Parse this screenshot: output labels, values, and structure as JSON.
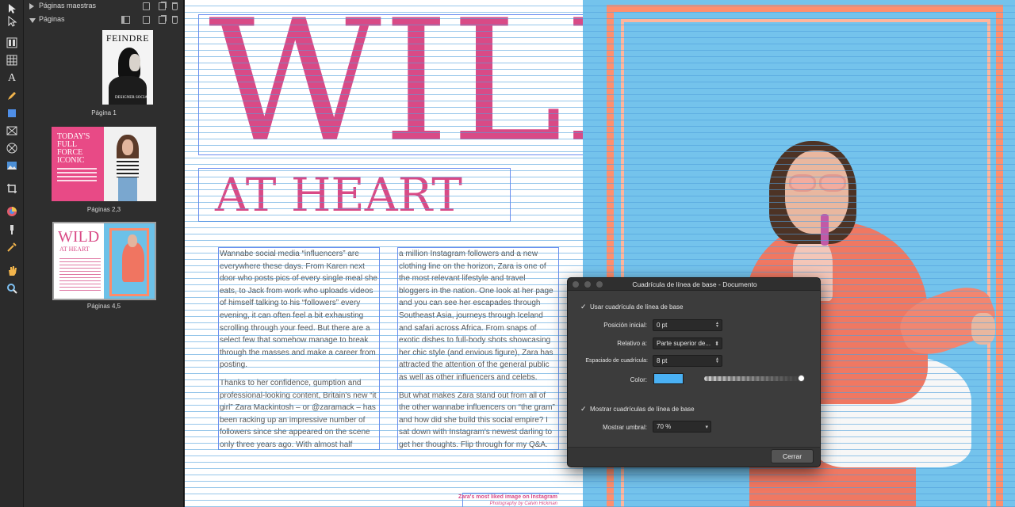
{
  "pages_panel": {
    "master_pages_label": "Páginas maestras",
    "pages_label": "Páginas",
    "thumbnails": [
      {
        "caption": "Página 1",
        "cover_title": "FEINDRE",
        "cover_footer": "DESIGNER SOCIAL"
      },
      {
        "caption": "Páginas 2,3",
        "cover_text": "TODAY'S FULL FORCE ICONIC"
      },
      {
        "caption": "Páginas 4,5",
        "wild": "WILD",
        "heart": "AT HEART"
      }
    ]
  },
  "toolbar": {
    "icons": [
      "move-tool-icon",
      "node-tool-icon",
      "frame-text-tool-icon",
      "table-tool-icon",
      "artistic-text-tool-icon",
      "pen-tool-icon",
      "rectangle-tool-icon",
      "picture-frame-tool-icon",
      "ellipse-frame-tool-icon",
      "place-image-tool-icon",
      "crop-tool-icon",
      "color-picker-tool-icon",
      "fill-tool-icon",
      "eyedropper-tool-icon",
      "hand-tool-icon",
      "zoom-tool-icon"
    ]
  },
  "document": {
    "headline": "WILD",
    "subheadline": "AT HEART",
    "column1": [
      "Wannabe social media “influencers” are everywhere these days. From Karen next door who posts pics of every single meal she eats, to Jack from work who uploads videos of himself talking to his “followers” every evening, it can often feel a bit exhausting scrolling through your feed. But there are a select few that somehow manage to break through the masses and make a career from posting.",
      "Thanks to her confidence, gumption and professional-looking content, Britain's new “it girl” Zara Mackintosh – or @zaramack – has been racking up an impressive number of followers since she appeared on the scene only three years ago. With almost half"
    ],
    "column2": [
      "a million Instagram followers and a new clothing line on the horizon, Zara is one of the most relevant lifestyle and travel bloggers in the nation. One look at her page and you can see her escapades through Southeast Asia, journeys through Iceland and safari across Africa. From snaps of exotic dishes to full-body shots showcasing her chic style (and envious figure), Zara has attracted the attention of the general public as well as other influencers and celebs.",
      "But what makes Zara stand out from all of the other wannabe influencers on “the gram” and how did she build this social empire? I sat down with Instagram's newest darling to get her thoughts. Flip through for my Q&A."
    ],
    "caption_title": "Zara's most liked image on Instagram",
    "caption_credit": "Photography by Calvin Hickman"
  },
  "dialog": {
    "title": "Cuadrícula de línea de base - Documento",
    "use_grid_label": "Usar cuadrícula de línea de base",
    "use_grid_checked": true,
    "start_position_label": "Posición inicial:",
    "start_position_value": "0 pt",
    "relative_to_label": "Relativo a:",
    "relative_to_value": "Parte superior de...",
    "grid_spacing_label": "Espaciado de cuadrícula:",
    "grid_spacing_value": "8 pt",
    "color_label": "Color:",
    "color_value": "#4ab1f4",
    "opacity_fraction": 1.0,
    "show_grids_label": "Mostrar cuadrículas de línea de base",
    "show_grids_checked": true,
    "threshold_label": "Mostrar umbral:",
    "threshold_value": "70 %",
    "close_label": "Cerrar"
  },
  "colors": {
    "accent_pink": "#d94a86",
    "frame_blue": "#6b8ef0",
    "grid_color": "#4ab1f4",
    "right_page_bg": "#74c3ec",
    "frame_orange": "#ff8f6e"
  }
}
